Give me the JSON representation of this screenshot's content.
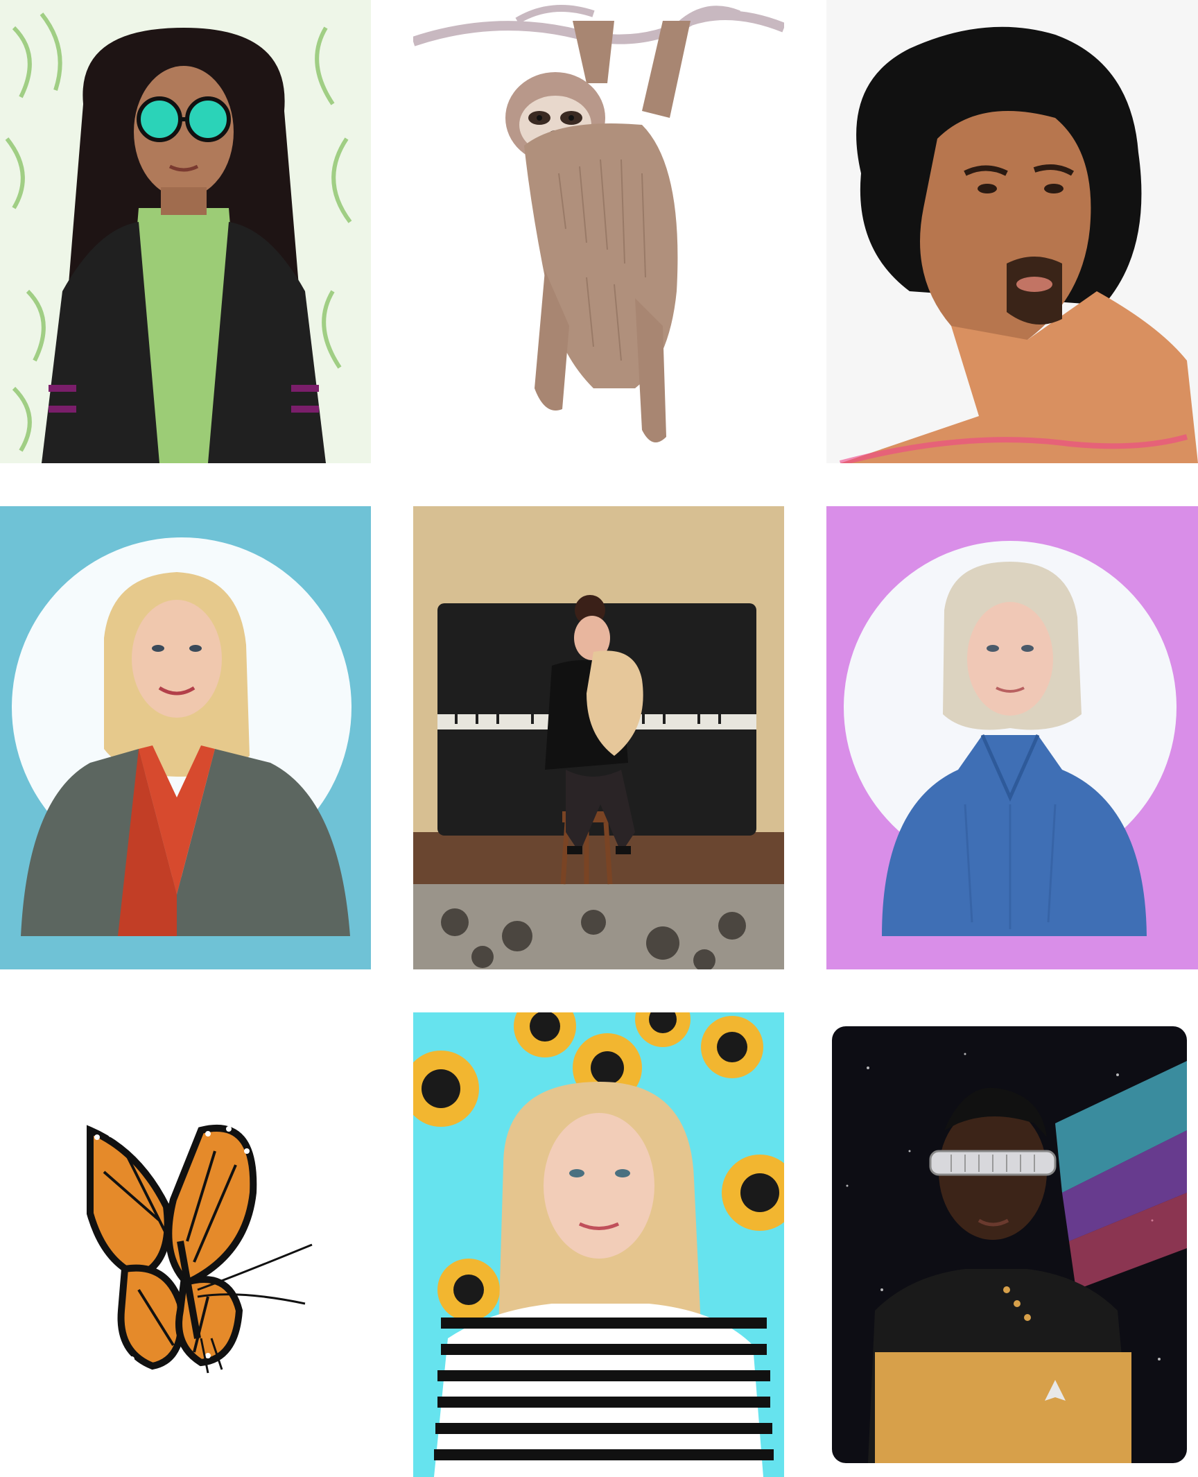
{
  "gallery": {
    "tiles": [
      {
        "icon": "woman-curly-hair-sunglasses-portrait",
        "background": "#e8f4e0",
        "accent": "#2bd3b8"
      },
      {
        "icon": "sloth-hanging-branch-illustration",
        "background": "#ffffff",
        "accent": "#b08c78"
      },
      {
        "icon": "man-afro-goatee-portrait",
        "background": "#f8f8f8",
        "accent": "#e8a070"
      },
      {
        "icon": "woman-blonde-blazer-portrait",
        "background": "#6fc2d6",
        "accent": "#d74a2e"
      },
      {
        "icon": "woman-piano-cat-painting",
        "background": "#d9c092",
        "accent": "#1c1c1c"
      },
      {
        "icon": "woman-blue-blouse-portrait",
        "background": "#d98ee8",
        "accent": "#3f6fb5"
      },
      {
        "icon": "monarch-butterfly-illustration",
        "background": "#ffffff",
        "accent": "#e58a2a"
      },
      {
        "icon": "woman-striped-shirt-sunflowers-portrait",
        "background": "#66e3ee",
        "accent": "#f2b630"
      },
      {
        "icon": "man-visor-space-uniform-portrait",
        "background": "#0d0d14",
        "accent": "#d7a04a"
      }
    ]
  }
}
